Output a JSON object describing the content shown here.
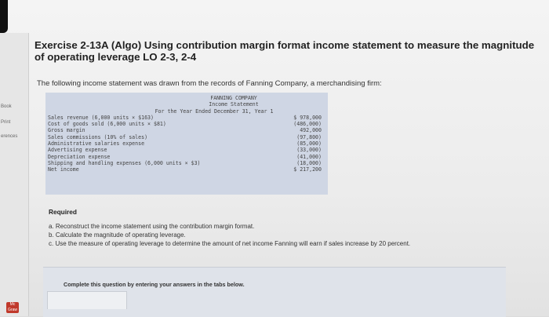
{
  "title": "Exercise 2-13A (Algo) Using contribution margin format income statement to measure the magnitude of operating leverage LO 2-3, 2-4",
  "intro": "The following income statement was drawn from the records of Fanning Company, a merchandising firm:",
  "sidebar": {
    "items": [
      "Book",
      "Print",
      "erences"
    ]
  },
  "statement": {
    "company": "FANNING COMPANY",
    "name": "Income Statement",
    "period": "For the Year Ended December 31, Year 1",
    "rows": [
      {
        "label": "Sales revenue (6,000 units × $163)",
        "amount": "$ 978,000"
      },
      {
        "label": "Cost of goods sold (6,000 units × $81)",
        "amount": "(486,000)"
      },
      {
        "label": "Gross margin",
        "amount": "492,000"
      },
      {
        "label": "Sales commissions (10% of sales)",
        "amount": "(97,800)"
      },
      {
        "label": "Administrative salaries expense",
        "amount": "(85,000)"
      },
      {
        "label": "Advertising expense",
        "amount": "(33,000)"
      },
      {
        "label": "Depreciation expense",
        "amount": "(41,000)"
      },
      {
        "label": "Shipping and handling expenses (6,000 units × $3)",
        "amount": "(18,000)"
      },
      {
        "label": "Net income",
        "amount": "$ 217,200"
      }
    ]
  },
  "required": {
    "heading": "Required",
    "items": [
      "a. Reconstruct the income statement using the contribution margin format.",
      "b. Calculate the magnitude of operating leverage.",
      "c. Use the measure of operating leverage to determine the amount of net income Fanning will earn if sales increase by 20 percent."
    ]
  },
  "instruction": "Complete this question by entering your answers in the tabs below.",
  "icons": {
    "brand": "mcgraw-hill-education-icon"
  }
}
